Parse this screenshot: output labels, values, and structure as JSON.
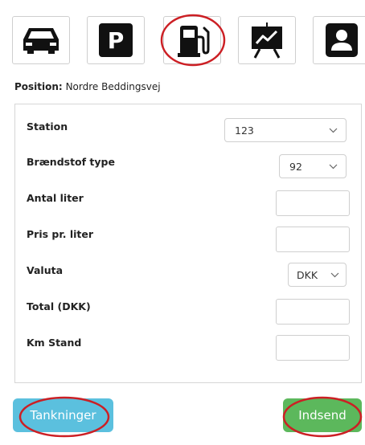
{
  "nav": {
    "icons": [
      {
        "name": "car-icon"
      },
      {
        "name": "parking-icon",
        "letter": "P"
      },
      {
        "name": "fuel-pump-icon"
      },
      {
        "name": "chart-board-icon"
      },
      {
        "name": "user-profile-icon"
      }
    ],
    "active_index": 2
  },
  "position": {
    "label": "Position:",
    "value": "Nordre Beddingsvej"
  },
  "form": {
    "station": {
      "label": "Station",
      "value": "123"
    },
    "fuel_type": {
      "label": "Brændstof type",
      "value": "92"
    },
    "liters": {
      "label": "Antal liter",
      "value": ""
    },
    "price_per_liter": {
      "label": "Pris pr. liter",
      "value": ""
    },
    "currency": {
      "label": "Valuta",
      "value": "DKK"
    },
    "total": {
      "label": "Total (DKK)",
      "value": ""
    },
    "odometer": {
      "label": "Km Stand",
      "value": ""
    }
  },
  "buttons": {
    "refuelings": "Tankninger",
    "submit": "Indsend"
  },
  "colors": {
    "info": "#5bc0de",
    "success": "#5cb85c",
    "highlight_ring": "#cc1f24"
  }
}
